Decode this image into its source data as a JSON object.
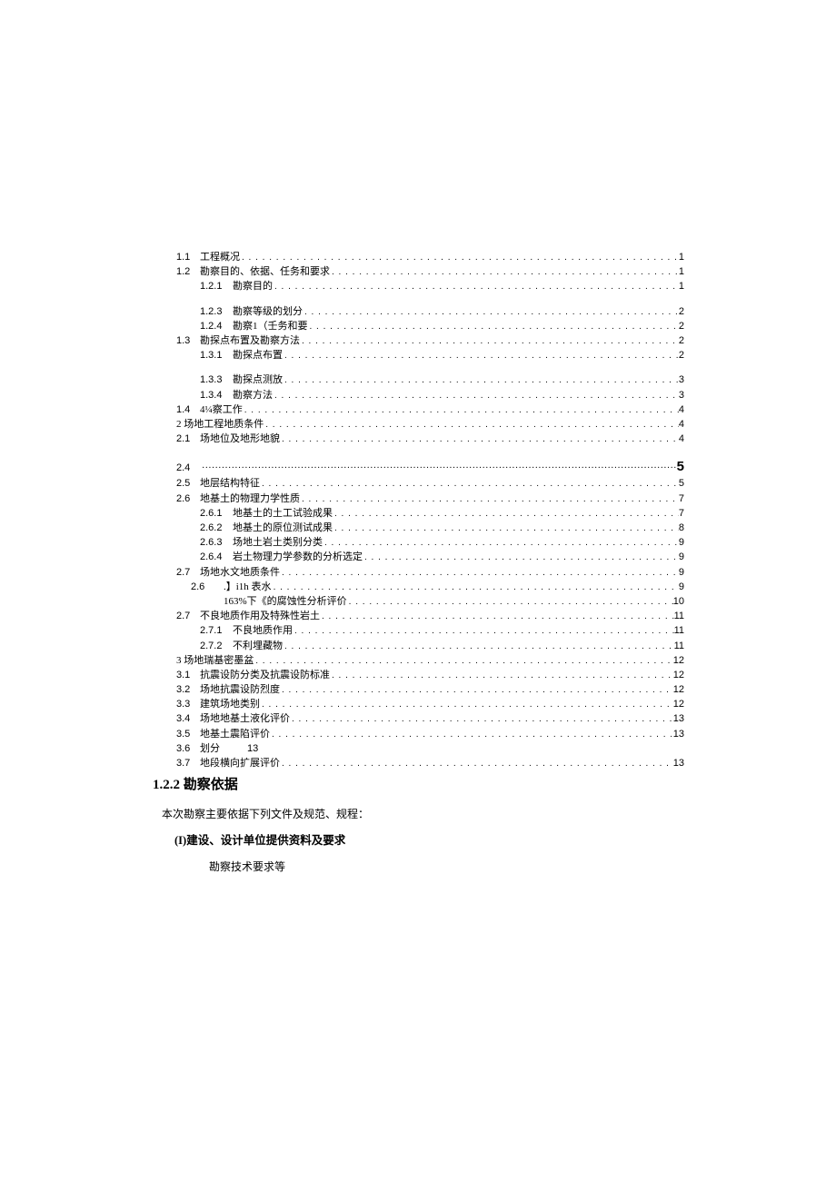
{
  "toc": [
    {
      "lvl": "l1",
      "num": "1.1",
      "title": "工程概况",
      "page": "1"
    },
    {
      "lvl": "l1",
      "num": "1.2",
      "title": "勘察目的、依据、任务和要求",
      "page": "1"
    },
    {
      "lvl": "l2",
      "num": "1.2.1",
      "title": "勘察目的",
      "page": "1"
    },
    {
      "lvl": "gap"
    },
    {
      "lvl": "l2",
      "num": "1.2.3",
      "title": "勘察等级的划分",
      "page": "2"
    },
    {
      "lvl": "l2",
      "num": "1.2.4",
      "title": "勘察1（壬务和要",
      "page": "2"
    },
    {
      "lvl": "l1",
      "num": "1.3",
      "title": "勘探点布置及勘察方法",
      "page": "2"
    },
    {
      "lvl": "l2",
      "num": "1.3.1",
      "title": "勘探点布置",
      "page": "2"
    },
    {
      "lvl": "gap"
    },
    {
      "lvl": "l2",
      "num": "1.3.3",
      "title": "勘探点测放",
      "page": "3"
    },
    {
      "lvl": "l2",
      "num": "1.3.4",
      "title": "勘察方法",
      "page": "3"
    },
    {
      "lvl": "l1",
      "num": "1.4",
      "title": "4¼察工作",
      "page": "4"
    },
    {
      "lvl": "l0",
      "num": "",
      "title": "2 场地工程地质条件",
      "page": "4"
    },
    {
      "lvl": "l1",
      "num": "2.1",
      "title": "场地位及地形地貌",
      "page": "4"
    },
    {
      "lvl": "gap"
    },
    {
      "lvl": "special24"
    },
    {
      "lvl": "l1",
      "num": "2.5",
      "title": "地层结构特征",
      "page": "5"
    },
    {
      "lvl": "l1",
      "num": "2.6",
      "title": "地基土的物理力学性质",
      "page": "7"
    },
    {
      "lvl": "l2",
      "num": "2.6.1",
      "title": "地基土的土工试验成果",
      "page": "7"
    },
    {
      "lvl": "l2",
      "num": "2.6.2",
      "title": "地基土的原位测试成果",
      "page": "8"
    },
    {
      "lvl": "l2",
      "num": "2.6.3",
      "title": "场地土岩土类别分类",
      "page": "9"
    },
    {
      "lvl": "l2",
      "num": "2.6.4",
      "title": "岩土物理力学参数的分析选定",
      "page": "9"
    },
    {
      "lvl": "l1",
      "num": "2.7",
      "title": "场地水文地质条件",
      "page": "9"
    },
    {
      "lvl": "l2b",
      "num": "2.6",
      "title": ".】i1h 表水",
      "page": "9"
    },
    {
      "lvl": "l2b",
      "num": "",
      "title": "163%下《的腐蚀性分析评价",
      "page": "10"
    },
    {
      "lvl": "l1",
      "num": "2.7",
      "title": "不良地质作用及特殊性岩土",
      "page": "11"
    },
    {
      "lvl": "l2",
      "num": "2.7.1",
      "title": "不良地质作用",
      "page": "11"
    },
    {
      "lvl": "l2",
      "num": "2.7.2",
      "title": "不利埋藏物",
      "page": "11"
    },
    {
      "lvl": "l0",
      "num": "",
      "title": "3 场地瑞基密墨盆",
      "page": "12"
    },
    {
      "lvl": "l1",
      "num": "3.1",
      "title": "抗震设防分类及抗震设防标准",
      "page": "12"
    },
    {
      "lvl": "l1",
      "num": "3.2",
      "title": "场地抗震设防烈度",
      "page": "12"
    },
    {
      "lvl": "l1",
      "num": "3.3",
      "title": "建筑场地类别",
      "page": "12"
    },
    {
      "lvl": "l1",
      "num": "3.4",
      "title": "场地地基土液化评价",
      "page": "13"
    },
    {
      "lvl": "l1",
      "num": "3.5",
      "title": "地基土震陷评价",
      "page": "13"
    },
    {
      "lvl": "l1nopage",
      "num": "3.6",
      "title": "划分",
      "page": "13"
    },
    {
      "lvl": "l1",
      "num": "3.7",
      "title": "地段横向扩展评价",
      "page": "13"
    }
  ],
  "section24": {
    "num": "2.4",
    "page": "5"
  },
  "heading": "1.2.2 勘察依据",
  "body1": "本次勘察主要依据下列文件及规范、规程：",
  "sub1": "(I)建设、设计单位提供资料及要求",
  "body2": "勘察技术要求等"
}
